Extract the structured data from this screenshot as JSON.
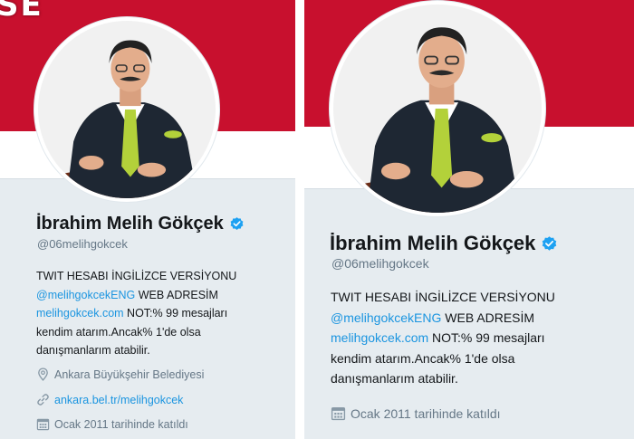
{
  "left_panel": {
    "banner_text": "SE",
    "name": "İbrahim Melih Gökçek",
    "handle": "@06melihgokcek",
    "bio": {
      "line1": "TWIT HESABI İNGİLİZCE VERSİYONU",
      "line2_link": "@melihgokcekENG",
      "line2_text": " WEB ADRESİM",
      "line3_link": "melihgokcek.com",
      "line3_text": " NOT:% 99 mesajları",
      "line4": "kendim atarım.Ancak% 1'de olsa",
      "line5": "danışmanlarım atabilir."
    },
    "location": "Ankara Büyükşehir Belediyesi",
    "url": "ankara.bel.tr/melihgokcek",
    "joined": "Ocak 2011 tarihinde katıldı",
    "icons": {
      "verified": "verified-badge-icon",
      "location": "location-pin-icon",
      "url": "link-icon",
      "joined": "calendar-icon"
    }
  },
  "right_panel": {
    "name": "İbrahim Melih Gökçek",
    "handle": "@06melihgokcek",
    "bio": {
      "line1": "TWIT HESABI İNGİLİZCE VERSİYONU",
      "line2_link": "@melihgokcekENG",
      "line2_text": " WEB ADRESİM",
      "line3_link": "melihgokcek.com",
      "line3_text": " NOT:% 99 mesajları",
      "line4": "kendim atarım.Ancak% 1'de olsa",
      "line5": "danışmanlarım atabilir."
    },
    "joined": "Ocak 2011 tarihinde katıldı",
    "icons": {
      "verified": "verified-badge-icon",
      "joined": "calendar-icon"
    }
  },
  "colors": {
    "banner_red": "#c8102e",
    "card_bg": "#e6ecf0",
    "link_blue": "#1b95e0",
    "name_text": "#14171a",
    "secondary_text": "#657786"
  }
}
